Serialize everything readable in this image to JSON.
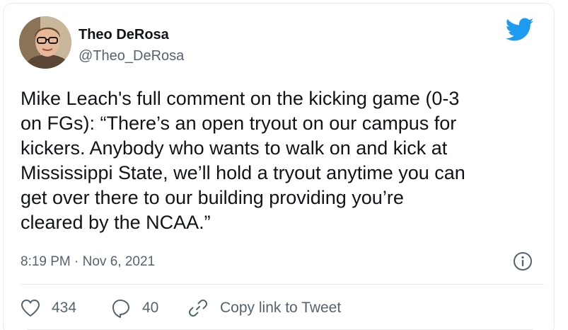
{
  "author": {
    "name": "Theo DeRosa",
    "handle": "@Theo_DeRosa",
    "avatar": "profile-photo"
  },
  "brand_icon": "twitter-bird-icon",
  "tweet": {
    "text": "Mike Leach's full comment on the kicking game (0-3\non FGs): “There’s an open tryout on our campus for\nkickers. Anybody who wants to walk on and kick at\nMississippi State, we’ll hold a tryout anytime you can\nget over there to our building providing you’re\ncleared by the NCAA.”",
    "timestamp": "8:19 PM · Nov 6, 2021"
  },
  "actions": {
    "like_count": "434",
    "reply_count": "40",
    "copy_link_label": "Copy link to Tweet"
  },
  "colors": {
    "twitter_blue": "#1d9bf0",
    "secondary_text": "#536471",
    "primary_text": "#0f1419",
    "border": "#e6ecf0"
  }
}
